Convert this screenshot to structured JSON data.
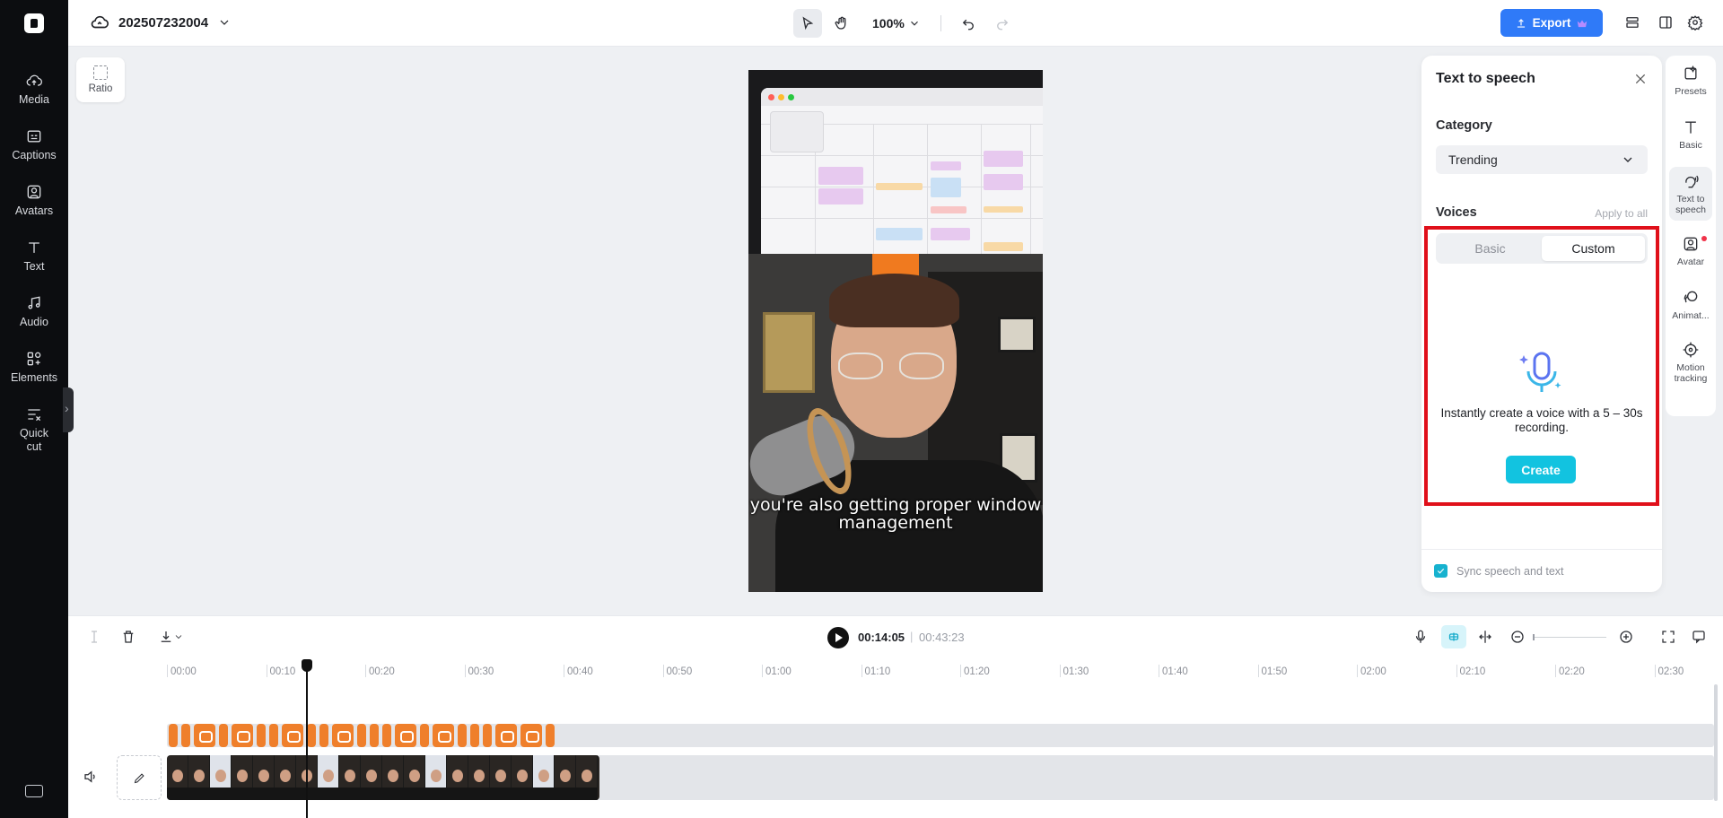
{
  "project": {
    "name": "202507232004"
  },
  "toolbar": {
    "zoom": "100%",
    "export_label": "Export"
  },
  "sidebar": {
    "items": [
      {
        "label": "Media",
        "icon": "cloud-upload-icon"
      },
      {
        "label": "Captions",
        "icon": "captions-icon"
      },
      {
        "label": "Avatars",
        "icon": "avatar-icon"
      },
      {
        "label": "Text",
        "icon": "text-icon"
      },
      {
        "label": "Audio",
        "icon": "music-note-icon"
      },
      {
        "label": "Elements",
        "icon": "elements-icon"
      },
      {
        "label": "Quick cut",
        "icon": "quick-cut-icon"
      }
    ]
  },
  "canvas": {
    "ratio_label": "Ratio",
    "caption": "you're also getting proper window management"
  },
  "tts": {
    "title": "Text to speech",
    "category_label": "Category",
    "category_value": "Trending",
    "voices_label": "Voices",
    "apply_all": "Apply to all",
    "tabs": [
      "Basic",
      "Custom"
    ],
    "selected_tab": "Custom",
    "empty_text": "Instantly create a voice with a 5 – 30s recording.",
    "create_label": "Create",
    "sync_label": "Sync speech and text",
    "sync_checked": true
  },
  "right_rail": {
    "items": [
      {
        "label": "Presets",
        "icon": "presets-icon"
      },
      {
        "label": "Basic",
        "icon": "text-icon"
      },
      {
        "label": "Text to speech",
        "icon": "speech-icon"
      },
      {
        "label": "Avatar",
        "icon": "avatar-icon"
      },
      {
        "label": "Animat...",
        "icon": "animation-icon"
      },
      {
        "label": "Motion tracking",
        "icon": "motion-tracking-icon"
      }
    ]
  },
  "timeline": {
    "current_time": "00:14:05",
    "total_time": "00:43:23",
    "ruler": [
      "00:00",
      "00:10",
      "00:20",
      "00:30",
      "00:40",
      "00:50",
      "01:00",
      "01:10",
      "01:20",
      "01:30",
      "01:40",
      "01:50",
      "02:00",
      "02:10",
      "02:20",
      "02:30"
    ]
  },
  "colors": {
    "export": "#2f7af8",
    "create": "#12c3e0",
    "highlight": "#e0101a",
    "clip": "#ef7f2b"
  }
}
